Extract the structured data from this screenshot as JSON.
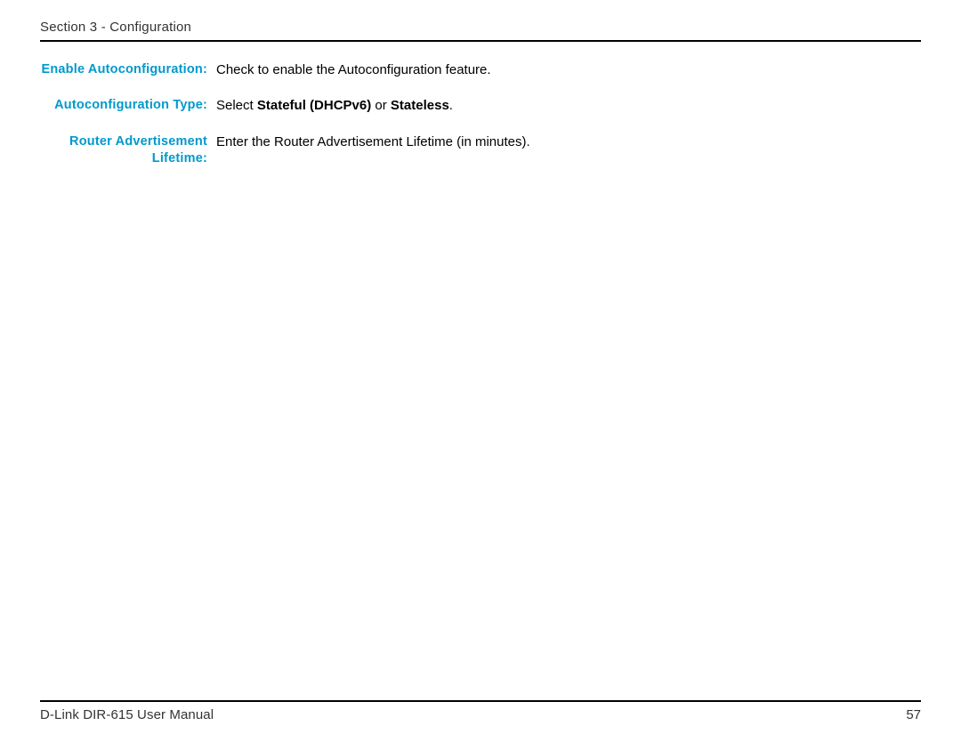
{
  "header": {
    "section_title": "Section 3 - Configuration"
  },
  "definitions": {
    "row1": {
      "label": "Enable Autoconfiguration:",
      "value_prefix": "Check to enable the Autoconfiguration feature."
    },
    "row2": {
      "label": "Autoconfiguration Type:",
      "value_prefix": "Select ",
      "value_bold1": "Stateful (DHCPv6)",
      "value_mid": " or ",
      "value_bold2": "Stateless",
      "value_suffix": "."
    },
    "row3": {
      "label": "Router Advertisement Lifetime:",
      "value_prefix": "Enter the Router Advertisement Lifetime (in minutes)."
    }
  },
  "footer": {
    "manual_title": "D-Link DIR-615 User Manual",
    "page_number": "57"
  }
}
